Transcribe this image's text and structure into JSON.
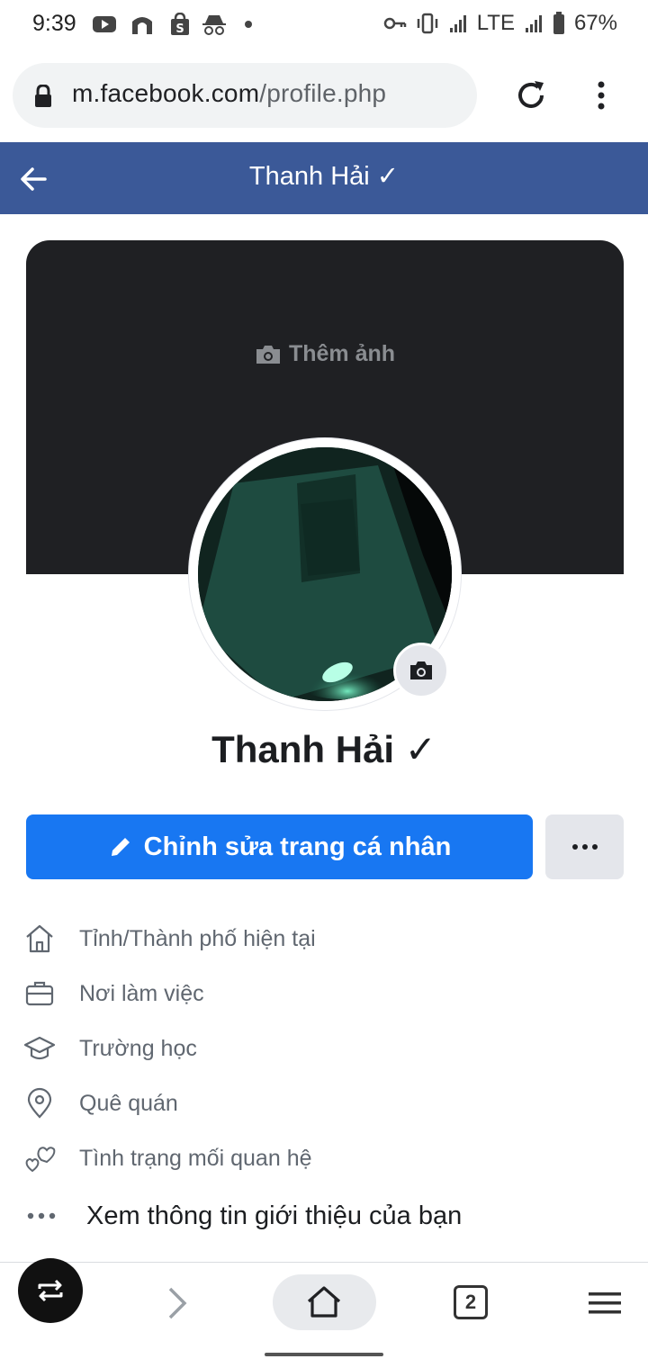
{
  "status_bar": {
    "time": "9:39",
    "network": "LTE",
    "battery": "67%"
  },
  "browser": {
    "url_host": "m.facebook.com",
    "url_path": "/profile.php",
    "tab_count": "2"
  },
  "header": {
    "title": "Thanh Hải ✓"
  },
  "cover": {
    "add_photo_label": "Thêm ảnh"
  },
  "profile": {
    "name": "Thanh Hải ✓",
    "edit_button_label": "Chỉnh sửa trang cá nhân",
    "more_button_label": "···"
  },
  "info": {
    "items": [
      {
        "icon": "home-icon",
        "label": "Tỉnh/Thành phố hiện tại"
      },
      {
        "icon": "briefcase-icon",
        "label": "Nơi làm việc"
      },
      {
        "icon": "graduation-cap-icon",
        "label": "Trường học"
      },
      {
        "icon": "location-pin-icon",
        "label": "Quê quán"
      },
      {
        "icon": "hearts-icon",
        "label": "Tình trạng mối quan hệ"
      }
    ],
    "see_more_label": "Xem thông tin giới thiệu của bạn"
  },
  "colors": {
    "fb_header": "#3b5998",
    "primary_button": "#1877f2",
    "cover_bg": "#1f2023"
  }
}
